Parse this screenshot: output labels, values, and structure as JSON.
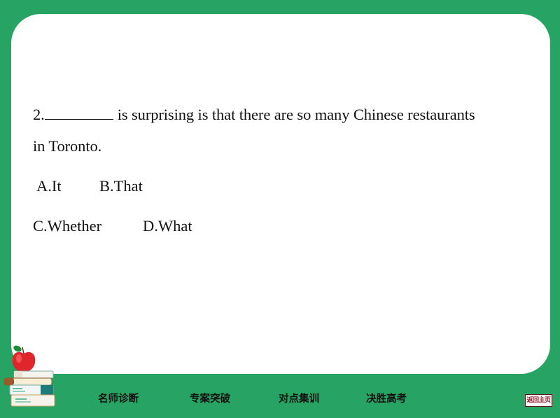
{
  "question": {
    "number": "2.",
    "line1_rest": "is surprising is that there are so many Chinese restaurants",
    "line2": "in Toronto.",
    "options": [
      {
        "label": "A.It"
      },
      {
        "label": "B.That"
      },
      {
        "label": "C.Whether"
      },
      {
        "label": "D.What"
      }
    ]
  },
  "nav": {
    "items": [
      {
        "label": "名师诊断"
      },
      {
        "label": "专案突破"
      },
      {
        "label": "对点集训"
      },
      {
        "label": "决胜高考"
      }
    ],
    "home_label": "返回主页"
  },
  "colors": {
    "background": "#27a463",
    "panel": "#ffffff",
    "home_text": "#8b1c2a"
  }
}
